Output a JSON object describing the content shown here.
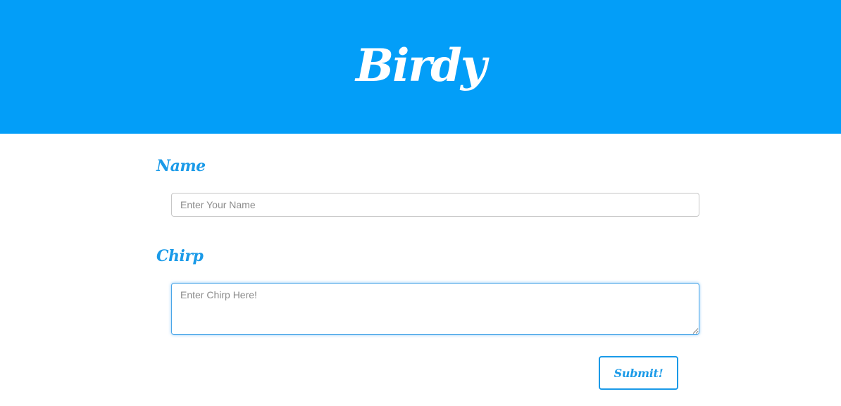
{
  "header": {
    "title": "Birdy",
    "background_color": "#039ef8"
  },
  "form": {
    "name": {
      "label": "Name",
      "placeholder": "Enter Your Name",
      "value": ""
    },
    "chirp": {
      "label": "Chirp",
      "placeholder": "Enter Chirp Here!",
      "value": ""
    },
    "submit_label": "Submit!",
    "accent_color": "#1a9ae8"
  }
}
